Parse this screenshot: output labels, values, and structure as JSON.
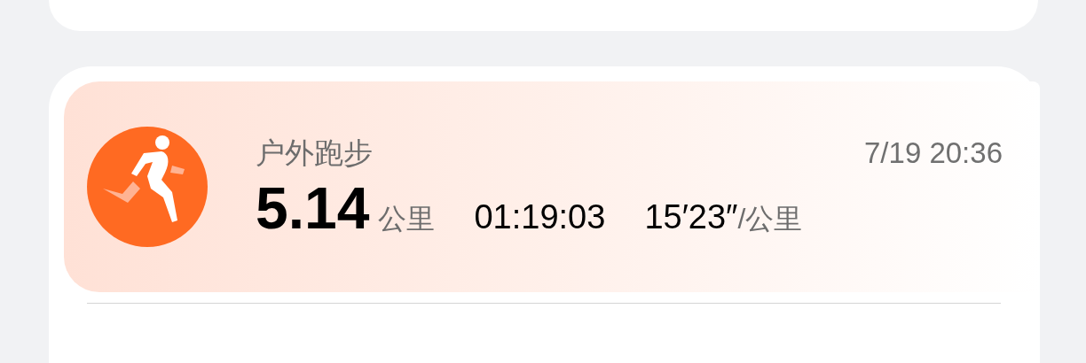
{
  "activity": {
    "name": "户外跑步",
    "datetime": "7/19 20:36",
    "distance": "5.14",
    "distance_unit": "公里",
    "duration": "01:19:03",
    "pace": "15′23″",
    "pace_unit": "/公里"
  }
}
